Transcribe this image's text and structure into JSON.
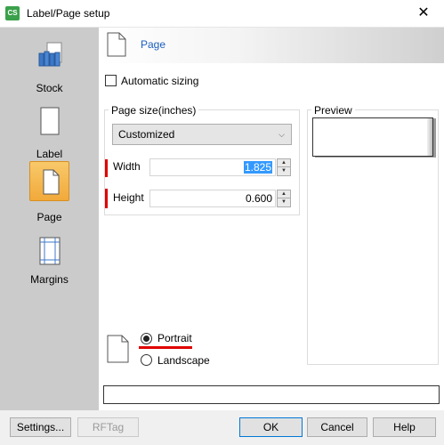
{
  "window": {
    "title": "Label/Page setup",
    "app_icon_text": "CS",
    "close_glyph": "✕"
  },
  "sidebar": {
    "items": [
      {
        "label": "Stock",
        "icon": "stock-books-icon",
        "selected": false
      },
      {
        "label": "Label",
        "icon": "label-page-icon",
        "selected": false
      },
      {
        "label": "Page",
        "icon": "page-icon",
        "selected": true
      },
      {
        "label": "Margins",
        "icon": "margins-icon",
        "selected": false
      }
    ]
  },
  "header": {
    "title": "Page",
    "icon": "page-icon"
  },
  "auto_sizing": {
    "label": "Automatic sizing",
    "checked": false
  },
  "page_size": {
    "group_title": "Page size(inches)",
    "selected_option": "Customized",
    "width_label": "Width",
    "width_value": "1.825",
    "height_label": "Height",
    "height_value": "0.600"
  },
  "preview": {
    "title": "Preview"
  },
  "orientation": {
    "portrait_label": "Portrait",
    "landscape_label": "Landscape",
    "selected": "Portrait"
  },
  "buttons": {
    "settings": "Settings...",
    "rftag": "RFTag",
    "ok": "OK",
    "cancel": "Cancel",
    "help": "Help"
  },
  "colors": {
    "accent_selected": "#f2a93a",
    "highlight_red": "#e00000",
    "link_blue": "#1b5fbf",
    "sidebar_bg": "#cbcbcb"
  }
}
